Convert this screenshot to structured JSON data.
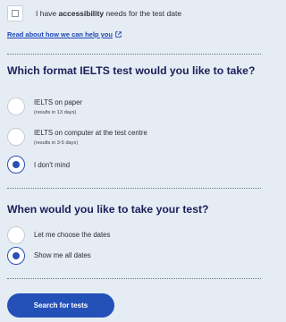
{
  "accessibility": {
    "text_before": "I have ",
    "text_bold": "accessibility",
    "text_after": " needs for the test date",
    "checked": false
  },
  "help_link": {
    "label": "Read about how we can help you",
    "icon": "external-link-icon"
  },
  "format_section": {
    "heading": "Which format IELTS test would you like to take?",
    "options": [
      {
        "label": "IELTS on paper",
        "sub": "(results in 13 days)",
        "selected": false
      },
      {
        "label": "IELTS on computer at the test centre",
        "sub": "(results in 3-5 days)",
        "selected": false
      },
      {
        "label": "I don't mind",
        "sub": "",
        "selected": true
      }
    ]
  },
  "date_section": {
    "heading": "When would you like to take your test?",
    "options": [
      {
        "label": "Let me choose the dates",
        "selected": false
      },
      {
        "label": "Show me all dates",
        "selected": true
      }
    ]
  },
  "search_button": {
    "label": "Search for tests"
  },
  "colors": {
    "background": "#e5ecf4",
    "heading": "#1d1f5a",
    "link": "#1c47b8",
    "accent": "#2451b8"
  }
}
